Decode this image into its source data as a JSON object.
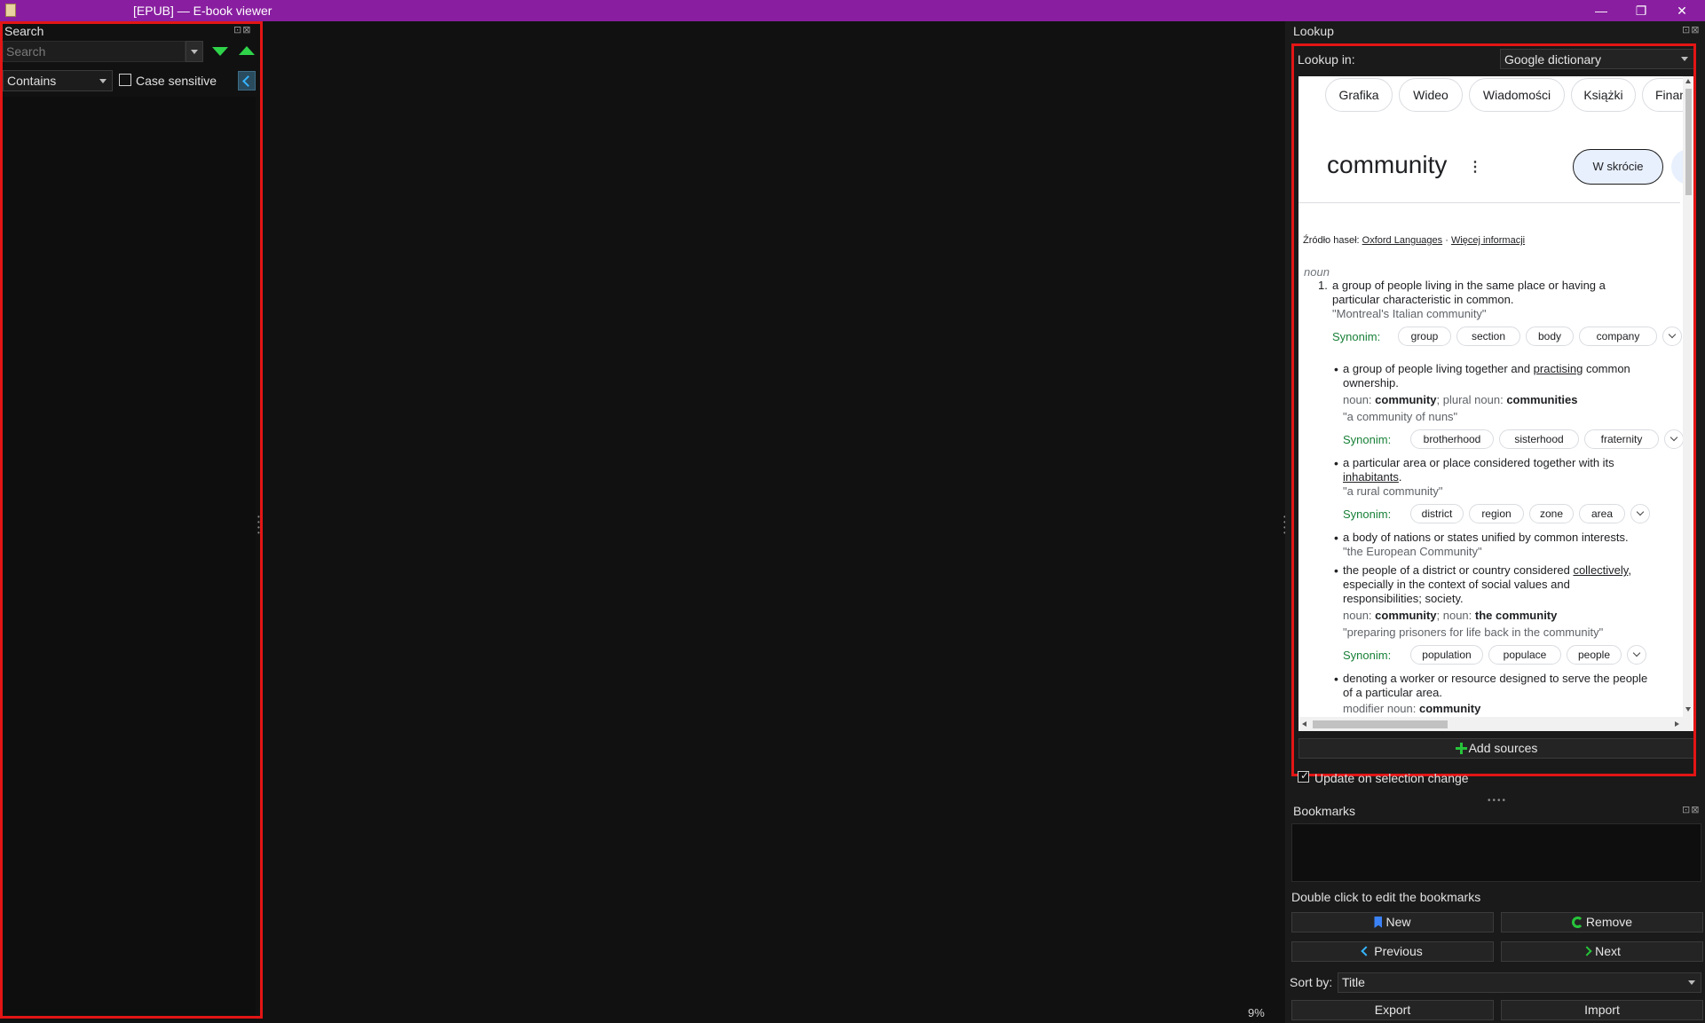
{
  "window": {
    "title": "[EPUB] — E-book viewer"
  },
  "search_panel": {
    "title": "Search",
    "dock_controls": "⊡⊠",
    "placeholder": "Search",
    "mode": "Contains",
    "case_sensitive_label": "Case sensitive",
    "case_sensitive": false
  },
  "lookup_panel": {
    "title": "Lookup",
    "dock_controls": "⊡⊠",
    "lookup_in_label": "Lookup in:",
    "source": "Google dictionary",
    "add_sources_label": "Add sources",
    "update_on_selection_label": "Update on selection change",
    "update_on_selection": true
  },
  "dictionary": {
    "tabs": [
      "Grafika",
      "Wideo",
      "Wiadomości",
      "Książki",
      "Finans"
    ],
    "word": "community",
    "brief_label": "W skrócie",
    "source_prefix": "Źródło haseł:",
    "source_name": "Oxford Languages",
    "more_info": "Więcej informacji",
    "part_of_speech": "noun",
    "synonym_label": "Synonim:",
    "def1": {
      "number": "1.",
      "line1": "a group of people living in the same place or having a",
      "line2": "particular characteristic in common.",
      "example": "\"Montreal's Italian community\"",
      "synonyms": [
        "group",
        "section",
        "body",
        "company"
      ]
    },
    "sub1": {
      "line1a": "a group of people living together and",
      "line1b": "practising",
      "line1c": "common",
      "line2": "ownership.",
      "form_prefix": "noun:",
      "form_word": "community",
      "form_mid": "; plural noun:",
      "form_plural": "communities",
      "example": "\"a community of nuns\"",
      "synonyms": [
        "brotherhood",
        "sisterhood",
        "fraternity"
      ]
    },
    "sub2": {
      "line1": "a particular area or place considered together with its",
      "line2": "inhabitants",
      "line2_end": ".",
      "example": "\"a rural community\"",
      "synonyms": [
        "district",
        "region",
        "zone",
        "area"
      ]
    },
    "sub3": {
      "line1": "a body of nations or states unified by common interests.",
      "example": "\"the European Community\""
    },
    "sub4": {
      "line1a": "the people of a district or country considered",
      "line1b": "collectively",
      "line1c": ",",
      "line2": "especially in the context of social values and",
      "line3": "responsibilities; society.",
      "form_prefix": "noun:",
      "form_word": "community",
      "form_mid": "; noun:",
      "form_second": "the community",
      "example": "\"preparing prisoners for life back in the community\"",
      "synonyms": [
        "population",
        "populace",
        "people"
      ]
    },
    "sub5": {
      "line1": "denoting a worker or resource designed to serve the people",
      "line2": "of a particular area.",
      "form_prefix": "modifier noun:",
      "form_word": "community"
    }
  },
  "bookmarks_panel": {
    "title": "Bookmarks",
    "dock_controls": "⊡⊠",
    "hint": "Double click to edit the bookmarks",
    "new_label": "New",
    "remove_label": "Remove",
    "previous_label": "Previous",
    "next_label": "Next",
    "sort_by_label": "Sort by:",
    "sort_by_value": "Title",
    "export_label": "Export",
    "import_label": "Import"
  },
  "reader": {
    "progress": "9%"
  },
  "colors": {
    "titlebar": "#891fa0",
    "highlight": "#e31515",
    "synonym_green": "#188038",
    "arrow_green": "#2fd34a"
  },
  "icons": {
    "app": "book-icon",
    "down": "arrow-down-icon",
    "up": "arrow-up-icon"
  }
}
